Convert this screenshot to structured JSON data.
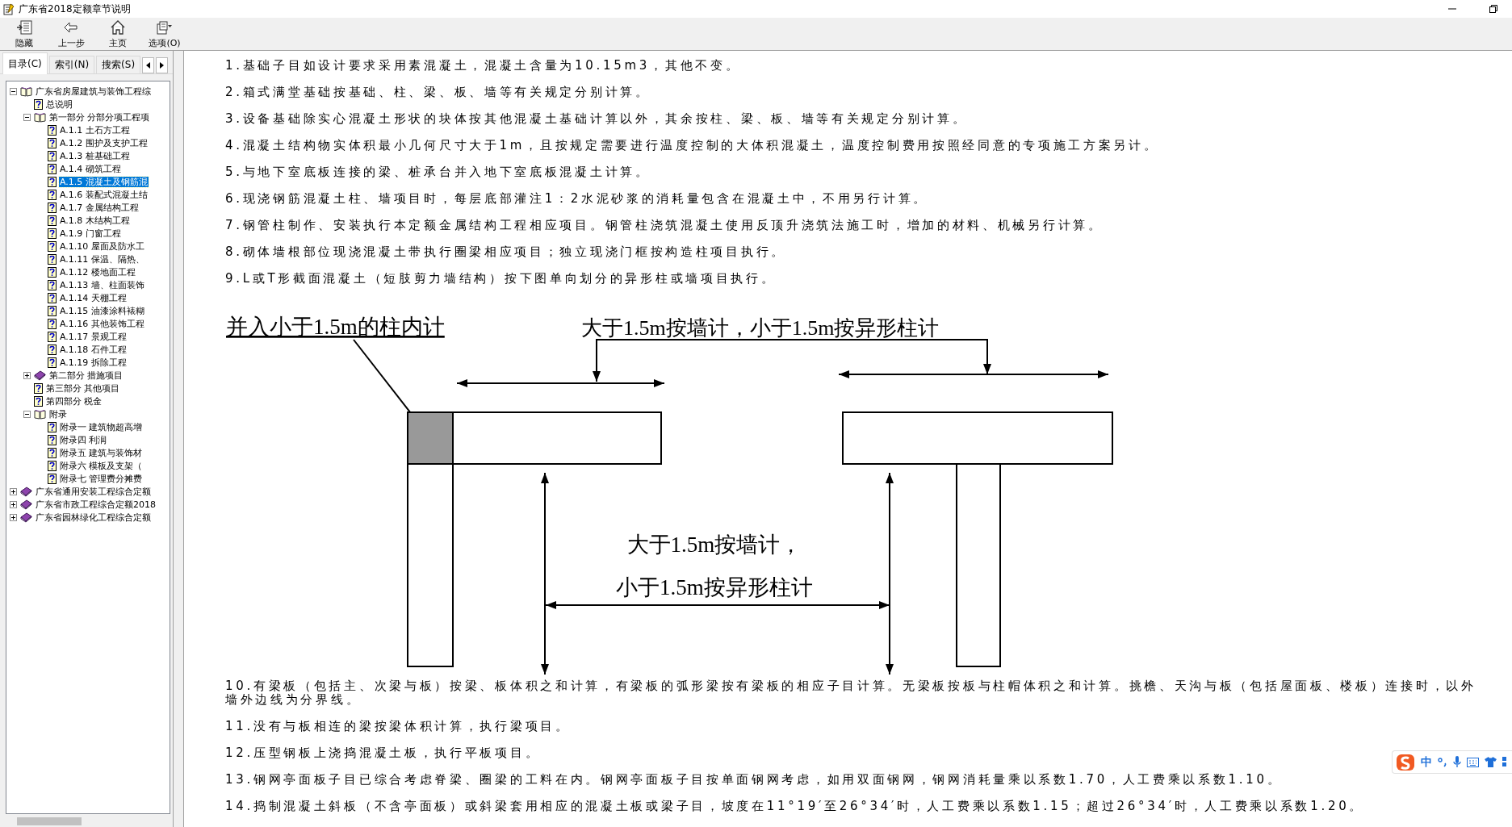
{
  "window": {
    "title": "广东省2018定额章节说明"
  },
  "toolbar": [
    {
      "label": "隐藏",
      "kind": "hide"
    },
    {
      "label": "上一步",
      "kind": "back"
    },
    {
      "label": "主页",
      "kind": "home"
    },
    {
      "label": "选项(O)",
      "kind": "options"
    }
  ],
  "tabs": [
    {
      "label": "目录(C)",
      "selected": true
    },
    {
      "label": "索引(N)",
      "selected": false
    },
    {
      "label": "搜索(S)",
      "selected": false
    }
  ],
  "tree": [
    {
      "label": "广东省房屋建筑与装饰工程综",
      "kind": "book",
      "expanded": true,
      "selected": false,
      "children": [
        {
          "label": "总说明",
          "kind": "page",
          "selected": false
        },
        {
          "label": "第一部分 分部分项工程项",
          "kind": "book",
          "expanded": true,
          "selected": false,
          "children": [
            {
              "label": "A.1.1 土石方工程",
              "kind": "page",
              "selected": false
            },
            {
              "label": "A.1.2 围护及支护工程",
              "kind": "page",
              "selected": false
            },
            {
              "label": "A.1.3 桩基础工程",
              "kind": "page",
              "selected": false
            },
            {
              "label": "A.1.4 砌筑工程",
              "kind": "page",
              "selected": false
            },
            {
              "label": "A.1.5 混凝土及钢筋混",
              "kind": "page",
              "selected": true
            },
            {
              "label": "A.1.6 装配式混凝土结",
              "kind": "page",
              "selected": false
            },
            {
              "label": "A.1.7 金属结构工程",
              "kind": "page",
              "selected": false
            },
            {
              "label": "A.1.8 木结构工程",
              "kind": "page",
              "selected": false
            },
            {
              "label": "A.1.9 门窗工程",
              "kind": "page",
              "selected": false
            },
            {
              "label": "A.1.10 屋面及防水工",
              "kind": "page",
              "selected": false
            },
            {
              "label": "A.1.11 保温、隔热、",
              "kind": "page",
              "selected": false
            },
            {
              "label": "A.1.12 楼地面工程",
              "kind": "page",
              "selected": false
            },
            {
              "label": "A.1.13 墙、柱面装饰",
              "kind": "page",
              "selected": false
            },
            {
              "label": "A.1.14 天棚工程",
              "kind": "page",
              "selected": false
            },
            {
              "label": "A.1.15 油漆涂料裱糊",
              "kind": "page",
              "selected": false
            },
            {
              "label": "A.1.16 其他装饰工程",
              "kind": "page",
              "selected": false
            },
            {
              "label": "A.1.17 景观工程",
              "kind": "page",
              "selected": false
            },
            {
              "label": "A.1.18 石件工程",
              "kind": "page",
              "selected": false
            },
            {
              "label": "A.1.19 拆除工程",
              "kind": "page",
              "selected": false
            }
          ]
        },
        {
          "label": "第二部分 措施项目",
          "kind": "book",
          "expanded": false,
          "selected": false
        },
        {
          "label": "第三部分 其他项目",
          "kind": "page",
          "selected": false
        },
        {
          "label": "第四部分 税金",
          "kind": "page",
          "selected": false
        },
        {
          "label": "附录",
          "kind": "book",
          "expanded": true,
          "selected": false,
          "children": [
            {
              "label": "附录一 建筑物超高增",
              "kind": "page",
              "selected": false
            },
            {
              "label": "附录四 利润",
              "kind": "page",
              "selected": false
            },
            {
              "label": "附录五 建筑与装饰材",
              "kind": "page",
              "selected": false
            },
            {
              "label": "附录六 模板及支架（",
              "kind": "page",
              "selected": false
            },
            {
              "label": "附录七 管理费分摊费",
              "kind": "page",
              "selected": false
            }
          ]
        }
      ]
    },
    {
      "label": "广东省通用安装工程综合定额",
      "kind": "book",
      "expanded": false,
      "selected": false
    },
    {
      "label": "广东省市政工程综合定额2018",
      "kind": "book",
      "expanded": false,
      "selected": false
    },
    {
      "label": "广东省园林绿化工程综合定额",
      "kind": "book",
      "expanded": false,
      "selected": false
    }
  ],
  "content": {
    "paragraphs_before": [
      "1.基础子目如设计要求采用素混凝土，混凝土含量为10.15m3，其他不变。",
      "2.箱式满堂基础按基础、柱、梁、板、墙等有关规定分别计算。",
      "3.设备基础除实心混凝土形状的块体按其他混凝土基础计算以外，其余按柱、梁、板、墙等有关规定分别计算。",
      "4.混凝土结构物实体积最小几何尺寸大于1m，且按规定需要进行温度控制的大体积混凝土，温度控制费用按照经同意的专项施工方案另计。",
      "5.与地下室底板连接的梁、桩承台并入地下室底板混凝土计算。",
      "6.现浇钢筋混凝土柱、墙项目时，每层底部灌注1：2水泥砂浆的消耗量包含在混凝土中，不用另行计算。",
      "7.钢管柱制作、安装执行本定额金属结构工程相应项目。钢管柱浇筑混凝土使用反顶升浇筑法施工时，增加的材料、机械另行计算。",
      "8.砌体墙根部位现浇混凝土带执行圈梁相应项目；独立现浇门框按构造柱项目执行。",
      "9.L或T形截面混凝土（短肢剪力墙结构）按下图单向划分的异形柱或墙项目执行。"
    ],
    "figure": {
      "corner_label": "并入小于1.5m的柱内计",
      "top_label": "大于1.5m按墙计，小于1.5m按异形柱计",
      "middle_label_lines": [
        "大于1.5m按墙计，",
        "小于1.5m按异形柱计"
      ]
    },
    "paragraphs_after": [
      "10.有梁板（包括主、次梁与板）按梁、板体积之和计算，有梁板的弧形梁按有梁板的相应子目计算。无梁板按板与柱帽体积之和计算。挑檐、天沟与板（包括屋面板、楼板）连接时，以外墙外边线为分界线。",
      "11.没有与板相连的梁按梁体积计算，执行梁项目。",
      "12.压型钢板上浇捣混凝土板，执行平板项目。",
      "13.钢网亭面板子目已综合考虑脊梁、圈梁的工料在内。钢网亭面板子目按单面钢网考虑，如用双面钢网，钢网消耗量乘以系数1.70，人工费乘以系数1.10。",
      "14.捣制混凝土斜板（不含亭面板）或斜梁套用相应的混凝土板或梁子目，坡度在11°19′至26°34′时，人工费乘以系数1.15；超过26°34′时，人工费乘以系数1.20。"
    ]
  },
  "ime_bar": {
    "mode": "中"
  }
}
